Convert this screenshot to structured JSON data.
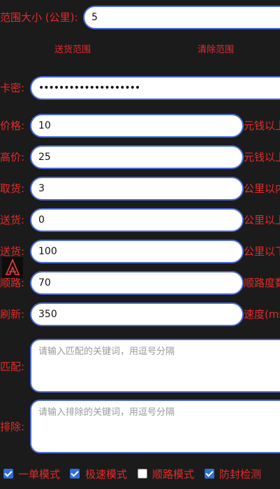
{
  "range": {
    "label": "范围大小 (公里):",
    "value": "5"
  },
  "buttons": {
    "delivery_range": "送货范围",
    "clear_range": "清除范围"
  },
  "card": {
    "label": "卡密:",
    "value": "••••••••••••••••••••"
  },
  "price": {
    "label": "价格:",
    "value": "10",
    "suffix": "元钱以上"
  },
  "high_price": {
    "label": "高价:",
    "value": "25",
    "suffix": "元钱以上"
  },
  "pickup": {
    "label": "取货:",
    "value": "3",
    "suffix": "公里以内"
  },
  "deliver1": {
    "label": "送货:",
    "value": "0",
    "suffix": "公里以上"
  },
  "deliver2": {
    "label": "送货:",
    "value": "100",
    "suffix": "公里以下"
  },
  "route": {
    "label": "顺路:",
    "value": "70",
    "suffix": "顺路度数"
  },
  "refresh": {
    "label": "刷新:",
    "value": "350",
    "suffix": "速度(ms)"
  },
  "match": {
    "label": "匹配:",
    "placeholder": "请输入匹配的关键词，用逗号分隔"
  },
  "exclude": {
    "label": "排除:",
    "placeholder": "请输入排除的关键词，用逗号分隔"
  },
  "modes": [
    {
      "label": "一单模式",
      "checked": true
    },
    {
      "label": "极速模式",
      "checked": true
    },
    {
      "label": "顺路模式",
      "checked": false
    },
    {
      "label": "防封检测",
      "checked": true
    }
  ],
  "colors": {
    "label_red": "#e52b2b",
    "field_border": "#4a6bd8",
    "check_blue": "#2f6fd6",
    "background": "#1b1b1b"
  }
}
